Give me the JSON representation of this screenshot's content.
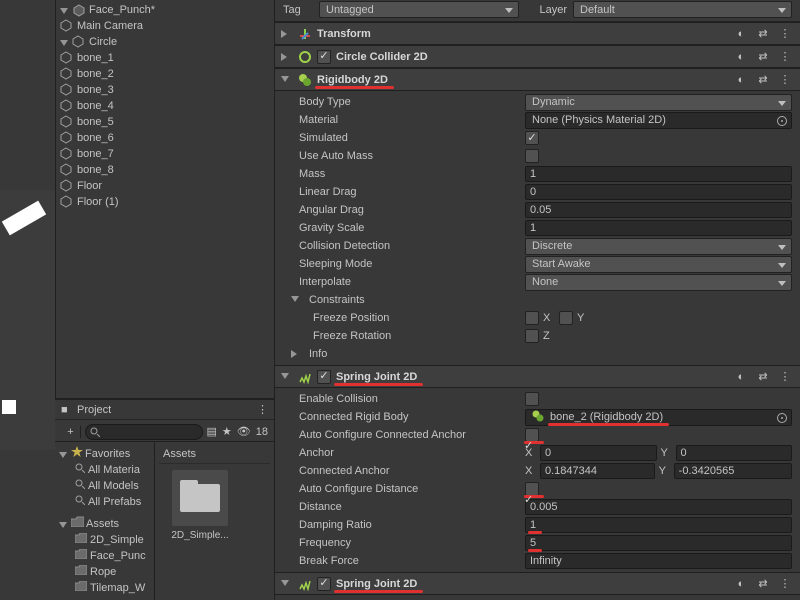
{
  "hierarchy": {
    "root": "Face_Punch*",
    "camera": "Main Camera",
    "circle": "Circle",
    "bones": [
      "bone_1",
      "bone_2",
      "bone_3",
      "bone_4",
      "bone_5",
      "bone_6",
      "bone_7",
      "bone_8"
    ],
    "floor1": "Floor",
    "floor2": "Floor (1)"
  },
  "project": {
    "panel_title": "Project",
    "plus": "+",
    "search_placeholder": "",
    "eye_count": "18",
    "favorites": "Favorites",
    "fav_items": [
      "All Materia",
      "All Models",
      "All Prefabs"
    ],
    "assets_label": "Assets",
    "asset_folders": [
      "2D_Simple",
      "Face_Punc",
      "Rope",
      "Tilemap_W"
    ],
    "breadcrumb": "Assets",
    "tile_name": "2D_Simple..."
  },
  "tagrow": {
    "tag_label": "Tag",
    "tag_value": "Untagged",
    "layer_label": "Layer",
    "layer_value": "Default"
  },
  "transform": {
    "title": "Transform"
  },
  "collider": {
    "title": "Circle Collider 2D"
  },
  "rigidbody": {
    "title": "Rigidbody 2D",
    "body_type_label": "Body Type",
    "body_type": "Dynamic",
    "material_label": "Material",
    "material": "None (Physics Material 2D)",
    "simulated_label": "Simulated",
    "autoMass_label": "Use Auto Mass",
    "mass_label": "Mass",
    "mass": "1",
    "linearDrag_label": "Linear Drag",
    "linearDrag": "0",
    "angularDrag_label": "Angular Drag",
    "angularDrag": "0.05",
    "gravity_label": "Gravity Scale",
    "gravity": "1",
    "colDet_label": "Collision Detection",
    "colDet": "Discrete",
    "sleep_label": "Sleeping Mode",
    "sleep": "Start Awake",
    "interp_label": "Interpolate",
    "interp": "None",
    "constraints_label": "Constraints",
    "freezePos_label": "Freeze Position",
    "X": "X",
    "Y": "Y",
    "freezeRot_label": "Freeze Rotation",
    "Z": "Z",
    "info_label": "Info"
  },
  "spring": {
    "title": "Spring Joint 2D",
    "enableCollision_label": "Enable Collision",
    "connectedRB_label": "Connected Rigid Body",
    "connectedRB": "bone_2 (Rigidbody 2D)",
    "autoAnchor_label": "Auto Configure Connected Anchor",
    "anchor_label": "Anchor",
    "anchorX": "0",
    "anchorY": "0",
    "connAnchor_label": "Connected Anchor",
    "connAnchorX": "0.1847344",
    "connAnchorY": "-0.3420565",
    "autoDist_label": "Auto Configure Distance",
    "distance_label": "Distance",
    "distance": "0.005",
    "damping_label": "Damping Ratio",
    "damping": "1",
    "frequency_label": "Frequency",
    "frequency": "5",
    "breakForce_label": "Break Force",
    "breakForce": "Infinity"
  },
  "spring2": {
    "title": "Spring Joint 2D"
  }
}
